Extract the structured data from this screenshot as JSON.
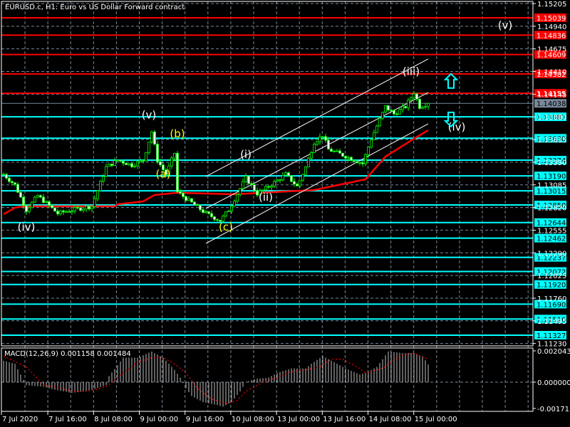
{
  "window": {
    "title": "EURUSD.c, H1:  Euro vs US Dollar Forward contract"
  },
  "colors": {
    "bg": "#000000",
    "grid": "#778899",
    "bull": "#00ff00",
    "bear_body": "#ffffff",
    "resistance": "#ff0000",
    "support": "#00ffff",
    "current": "#778899",
    "ma": "#ff0000",
    "channel": "#ffffff",
    "wave_white": "#ffffff",
    "wave_yellow": "#ffff00",
    "signal": "#ff0000",
    "histogram": "#c0c0c0"
  },
  "price_axis": {
    "max": 1.15205,
    "min": 1.11327,
    "grid_ticks": [
      "1.15205",
      "1.14940",
      "1.14675",
      "1.14410",
      "1.14145",
      "1.13880",
      "1.13615",
      "1.13350",
      "1.13085",
      "1.12820",
      "1.12555",
      "1.12290",
      "1.12025",
      "1.11760",
      "1.11495",
      "1.11230"
    ],
    "visible_tick_labels": [
      "1.15205",
      "1.14940",
      "1.14675",
      "1.13085",
      "1.12555",
      "1.12290",
      "1.11760"
    ]
  },
  "levels": {
    "resistance": [
      "1.15039",
      "1.14836",
      "1.14609",
      "1.14382",
      "1.14155"
    ],
    "current": "1.14038",
    "support": [
      "1.13881",
      "1.13630",
      "1.13374",
      "1.13190",
      "1.13015",
      "1.12850",
      "1.12644",
      "1.12462",
      "1.12237",
      "1.12072",
      "1.11920",
      "1.11690",
      "1.11516",
      "1.11327"
    ]
  },
  "time_axis": {
    "labels": [
      "7 Jul 2020",
      "7 Jul 16:00",
      "8 Jul 08:00",
      "9 Jul 00:00",
      "9 Jul 16:00",
      "10 Jul 08:00",
      "13 Jul 00:00",
      "13 Jul 16:00",
      "14 Jul 08:00",
      "15 Jul 00:00"
    ]
  },
  "chart_data": {
    "type": "candlestick",
    "symbol": "EURUSD.c",
    "timeframe": "H1",
    "bars": 150,
    "close_keypoints": [
      [
        0,
        1.13208
      ],
      [
        4,
        1.13083
      ],
      [
        8,
        1.12792
      ],
      [
        12,
        1.12958
      ],
      [
        19,
        1.1275
      ],
      [
        24,
        1.12792
      ],
      [
        31,
        1.12834
      ],
      [
        36,
        1.13291
      ],
      [
        40,
        1.13374
      ],
      [
        45,
        1.13316
      ],
      [
        49,
        1.13374
      ],
      [
        52,
        1.13707
      ],
      [
        54,
        1.13374
      ],
      [
        57,
        1.13208
      ],
      [
        60,
        1.13458
      ],
      [
        61,
        1.13
      ],
      [
        66,
        1.12875
      ],
      [
        71,
        1.1275
      ],
      [
        76,
        1.12667
      ],
      [
        79,
        1.12792
      ],
      [
        85,
        1.13166
      ],
      [
        89,
        1.12983
      ],
      [
        92,
        1.13042
      ],
      [
        99,
        1.13208
      ],
      [
        103,
        1.13067
      ],
      [
        106,
        1.13291
      ],
      [
        109,
        1.13583
      ],
      [
        112,
        1.13666
      ],
      [
        114,
        1.13499
      ],
      [
        119,
        1.13433
      ],
      [
        126,
        1.13333
      ],
      [
        129,
        1.13624
      ],
      [
        134,
        1.13999
      ],
      [
        137,
        1.13915
      ],
      [
        141,
        1.13999
      ],
      [
        144,
        1.14165
      ],
      [
        146,
        1.13999
      ],
      [
        149,
        1.14038
      ]
    ],
    "moving_average": [
      [
        0,
        1.12742
      ],
      [
        4,
        1.12817
      ],
      [
        7,
        1.12834
      ],
      [
        39,
        1.12834
      ],
      [
        40,
        1.12858
      ],
      [
        49,
        1.12892
      ],
      [
        53,
        1.12967
      ],
      [
        61,
        1.12992
      ],
      [
        81,
        1.12975
      ],
      [
        109,
        1.13025
      ],
      [
        121,
        1.13108
      ],
      [
        127,
        1.1315
      ],
      [
        134,
        1.13416
      ],
      [
        144,
        1.13624
      ],
      [
        149,
        1.13724
      ]
    ],
    "channel_lines": [
      {
        "name": "upper",
        "from": [
          71,
          1.13183
        ],
        "to": [
          149,
          1.14557
        ]
      },
      {
        "name": "middle",
        "from": [
          71,
          1.12809
        ],
        "to": [
          149,
          1.14165
        ]
      },
      {
        "name": "lower",
        "from": [
          71,
          1.124
        ],
        "to": [
          149,
          1.13799
        ]
      }
    ],
    "wave_labels": [
      {
        "text": "(iv)",
        "bar": 8,
        "price": 1.1255,
        "color": "white"
      },
      {
        "text": "(v)",
        "bar": 51,
        "price": 1.1386,
        "color": "white"
      },
      {
        "text": "(b)",
        "bar": 61,
        "price": 1.1364,
        "color": "yellow"
      },
      {
        "text": "(a)",
        "bar": 56,
        "price": 1.1317,
        "color": "yellow"
      },
      {
        "text": "(c)",
        "bar": 78,
        "price": 1.1255,
        "color": "yellow"
      },
      {
        "text": "(i)",
        "bar": 85,
        "price": 1.134,
        "color": "white"
      },
      {
        "text": "(ii)",
        "bar": 92,
        "price": 1.129,
        "color": "white"
      },
      {
        "text": "(iii)",
        "bar": 143,
        "price": 1.1437,
        "color": "white"
      },
      {
        "text": "(iv)",
        "bar": 159,
        "price": 1.1372,
        "color": "white"
      },
      {
        "text": "(v)",
        "bar": 176,
        "price": 1.1491,
        "color": "white"
      }
    ],
    "arrows": [
      {
        "dir": "up",
        "bar": 157,
        "price": 1.143
      },
      {
        "dir": "down",
        "bar": 157,
        "price": 1.1385
      }
    ],
    "macd": {
      "label": "MACD(12,26,9) 0.001158 0.001484",
      "params": "12,26,9",
      "main": 0.001158,
      "signal_value": 0.001484,
      "axis": {
        "max": 0.002043,
        "min": -0.001713,
        "labels": [
          "0.002043",
          "0.000000",
          "-0.001713"
        ]
      },
      "histogram": [
        [
          0,
          0.0014
        ],
        [
          4,
          0.0012
        ],
        [
          6,
          0.0005
        ],
        [
          8,
          -0.0002
        ],
        [
          14,
          -0.0003
        ],
        [
          18,
          -0.0005
        ],
        [
          24,
          -0.0007
        ],
        [
          31,
          -0.0005
        ],
        [
          36,
          -0.0002
        ],
        [
          37,
          0.0004
        ],
        [
          40,
          0.0011
        ],
        [
          42,
          0.0016
        ],
        [
          47,
          0.0016
        ],
        [
          52,
          0.002
        ],
        [
          56,
          0.0016
        ],
        [
          60,
          0.0008
        ],
        [
          62,
          0.0003
        ],
        [
          64,
          -0.0004
        ],
        [
          66,
          -0.0009
        ],
        [
          70,
          -0.0013
        ],
        [
          75,
          -0.0015
        ],
        [
          77,
          -0.0016
        ],
        [
          80,
          -0.0013
        ],
        [
          83,
          -0.0006
        ],
        [
          85,
          0.0
        ],
        [
          88,
          0.0002
        ],
        [
          93,
          0.0003
        ],
        [
          96,
          0.0006
        ],
        [
          101,
          0.0009
        ],
        [
          106,
          0.0009
        ],
        [
          108,
          0.0012
        ],
        [
          112,
          0.0017
        ],
        [
          116,
          0.0013
        ],
        [
          120,
          0.0009
        ],
        [
          125,
          0.0005
        ],
        [
          127,
          0.0006
        ],
        [
          131,
          0.001
        ],
        [
          135,
          0.002
        ],
        [
          140,
          0.0019
        ],
        [
          144,
          0.0019
        ],
        [
          147,
          0.0017
        ],
        [
          149,
          0.00116
        ]
      ],
      "signal": [
        [
          0,
          0.0017
        ],
        [
          8,
          0.001
        ],
        [
          12,
          0.0002
        ],
        [
          14,
          -0.0002
        ],
        [
          18,
          -0.0003
        ],
        [
          24,
          -0.0006
        ],
        [
          29,
          -0.0006
        ],
        [
          36,
          -0.0003
        ],
        [
          38,
          0.0
        ],
        [
          42,
          0.0006
        ],
        [
          47,
          0.0013
        ],
        [
          52,
          0.0016
        ],
        [
          56,
          0.0016
        ],
        [
          60,
          0.0012
        ],
        [
          64,
          0.0006
        ],
        [
          68,
          -0.0004
        ],
        [
          73,
          -0.0011
        ],
        [
          78,
          -0.0014
        ],
        [
          82,
          -0.0012
        ],
        [
          85,
          -0.0006
        ],
        [
          91,
          0.0
        ],
        [
          96,
          0.0003
        ],
        [
          101,
          0.0007
        ],
        [
          106,
          0.0008
        ],
        [
          111,
          0.001
        ],
        [
          115,
          0.0015
        ],
        [
          119,
          0.0015
        ],
        [
          124,
          0.001
        ],
        [
          127,
          0.0006
        ],
        [
          133,
          0.0009
        ],
        [
          139,
          0.0017
        ],
        [
          144,
          0.0019
        ],
        [
          149,
          0.00148
        ]
      ]
    }
  }
}
